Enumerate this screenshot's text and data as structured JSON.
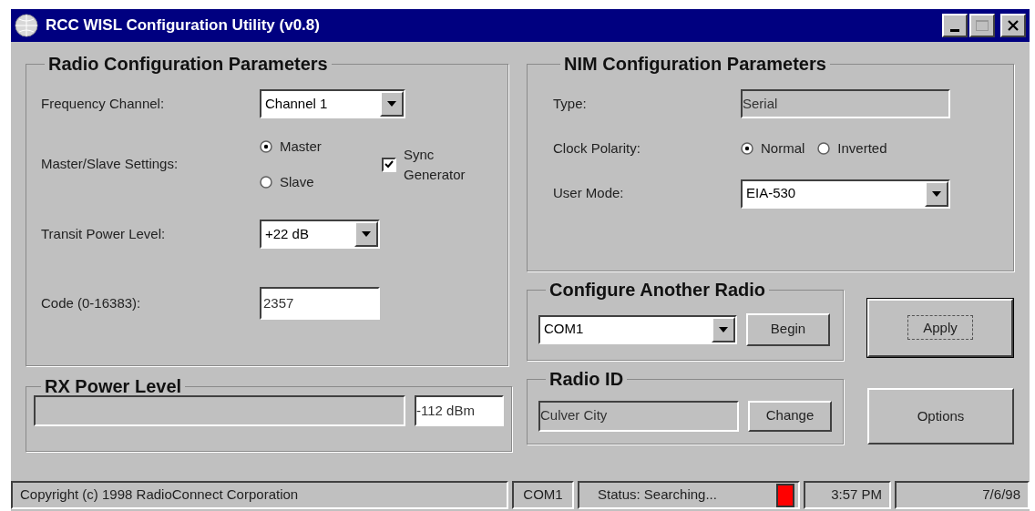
{
  "window": {
    "title": "RCC WISL Configuration Utility (v0.8)"
  },
  "radio_config": {
    "title": "Radio Configuration Parameters",
    "frequency_channel": {
      "label": "Frequency Channel:",
      "value": "Channel 1"
    },
    "master_slave": {
      "label": "Master/Slave Settings:",
      "options": [
        {
          "label": "Master",
          "selected": true
        },
        {
          "label": "Slave",
          "selected": false
        }
      ]
    },
    "sync_generator": {
      "label": "Sync Generator",
      "checked": true
    },
    "transmit_power": {
      "label": "Transit Power Level:",
      "value": "+22 dB"
    },
    "code": {
      "label": "Code (0-16383):",
      "value": "2357"
    }
  },
  "rx_power": {
    "title": "RX Power Level",
    "level": 0,
    "reading": "-112 dBm"
  },
  "nim_config": {
    "title": "NIM Configuration Parameters",
    "type": {
      "label": "Type:",
      "value": "Serial"
    },
    "clock_polarity": {
      "label": "Clock Polarity:",
      "options": [
        {
          "label": "Normal",
          "selected": true
        },
        {
          "label": "Inverted",
          "selected": false
        }
      ]
    },
    "user_mode": {
      "label": "User Mode:",
      "value": "EIA-530"
    }
  },
  "configure_another_radio": {
    "title": "Configure Another Radio",
    "port": "COM1",
    "button": "Begin"
  },
  "radio_id": {
    "title": "Radio ID",
    "value": "Culver City",
    "button": "Change"
  },
  "buttons": [
    {
      "label": "Apply",
      "default": true
    },
    {
      "label": "Options",
      "default": false
    }
  ],
  "status_bar": {
    "copyright": "Copyright (c) 1998 RadioConnect Corporation",
    "port": "COM1",
    "status": "Status: Searching...",
    "indicator": {
      "color": "#ff0000"
    },
    "time": "3:57 PM",
    "date": "7/6/98"
  }
}
